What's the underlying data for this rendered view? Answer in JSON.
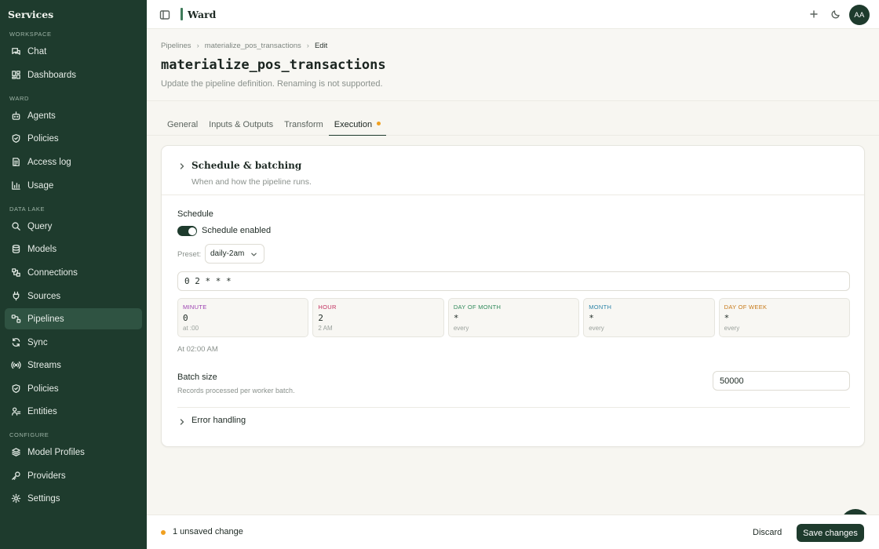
{
  "sidebar": {
    "brand": "Services",
    "sections": {
      "workspace": "WORKSPACE",
      "ward": "WARD",
      "data_lake": "DATA LAKE",
      "configure": "CONFIGURE"
    },
    "items": [
      {
        "label": "Chat",
        "icon": "chat-icon"
      },
      {
        "label": "Dashboards",
        "icon": "dashboard-icon"
      },
      {
        "label": "Agents",
        "icon": "agent-icon"
      },
      {
        "label": "Policies",
        "icon": "shield-icon"
      },
      {
        "label": "Access log",
        "icon": "log-icon"
      },
      {
        "label": "Usage",
        "icon": "bar-chart-icon"
      },
      {
        "label": "Query",
        "icon": "search-icon"
      },
      {
        "label": "Models",
        "icon": "database-icon"
      },
      {
        "label": "Connections",
        "icon": "connections-icon"
      },
      {
        "label": "Sources",
        "icon": "plug-icon"
      },
      {
        "label": "Pipelines",
        "icon": "pipeline-icon",
        "active": true
      },
      {
        "label": "Sync",
        "icon": "sync-icon"
      },
      {
        "label": "Streams",
        "icon": "broadcast-icon"
      },
      {
        "label": "Policies",
        "icon": "shield-icon"
      },
      {
        "label": "Entities",
        "icon": "entities-icon"
      },
      {
        "label": "Model Profiles",
        "icon": "layers-icon"
      },
      {
        "label": "Providers",
        "icon": "key-icon"
      },
      {
        "label": "Settings",
        "icon": "gear-icon"
      }
    ]
  },
  "topbar": {
    "title": "Ward",
    "avatar": "AA"
  },
  "header": {
    "breadcrumb": [
      "Pipelines",
      "materialize_pos_transactions",
      "Edit"
    ],
    "title": "materialize_pos_transactions",
    "subtitle": "Update the pipeline definition. Renaming is not supported."
  },
  "tabs": [
    {
      "label": "General"
    },
    {
      "label": "Inputs & Outputs"
    },
    {
      "label": "Transform"
    },
    {
      "label": "Execution",
      "active": true,
      "dirty": true
    }
  ],
  "section": {
    "title": "Schedule & batching",
    "subtitle": "When and how the pipeline runs."
  },
  "schedule": {
    "label": "Schedule",
    "toggle_label": "Schedule enabled",
    "enabled": true,
    "preset_label": "Preset:",
    "preset_value": "daily-2am",
    "cron": "0 2 * * *",
    "fields": [
      {
        "label": "MINUTE",
        "value": "0",
        "hint": "at :00",
        "color": "#9b3fb0"
      },
      {
        "label": "HOUR",
        "value": "2",
        "hint": "2 AM",
        "color": "#c2305f"
      },
      {
        "label": "DAY OF MONTH",
        "value": "*",
        "hint": "every",
        "color": "#2f8a5a"
      },
      {
        "label": "MONTH",
        "value": "*",
        "hint": "every",
        "color": "#2c84a8"
      },
      {
        "label": "DAY OF WEEK",
        "value": "*",
        "hint": "every",
        "color": "#c77a1a"
      }
    ],
    "next_run": "At 02:00 AM"
  },
  "batch": {
    "label": "Batch size",
    "hint": "Records processed per worker batch.",
    "value": "50000"
  },
  "error_handling": {
    "label": "Error handling"
  },
  "footer": {
    "status": "1 unsaved change",
    "discard": "Discard",
    "save": "Save changes"
  },
  "colors": {
    "sidebar_bg": "#1e3b2d",
    "accent": "#3f7b5a",
    "dirty_dot": "#f0a020"
  }
}
